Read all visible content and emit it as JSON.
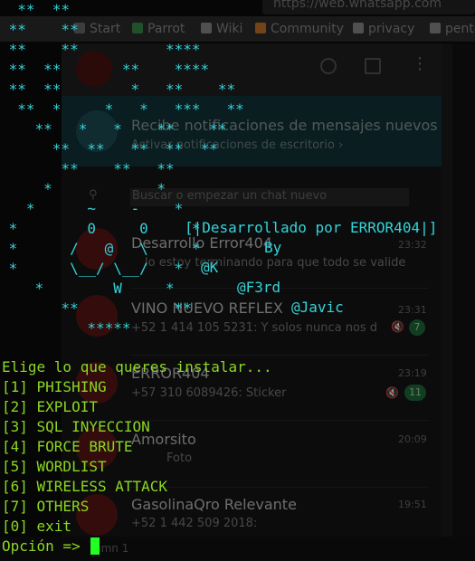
{
  "browser": {
    "url": "https://web.whatsapp.com",
    "bookmarks": [
      {
        "label": "Start",
        "color": "#6a6a6a"
      },
      {
        "label": "Parrot",
        "color": "#3a8a4a"
      },
      {
        "label": "Wiki",
        "color": "#8a8a8a"
      },
      {
        "label": "Community",
        "color": "#c9762a"
      },
      {
        "label": "privacy",
        "color": "#8a8a8a"
      },
      {
        "label": "pente",
        "color": "#8a8a8a"
      }
    ]
  },
  "whatsapp": {
    "notification": {
      "title": "Recibe notificaciones de mensajes nuevos",
      "link": "Activar notificaciones de escritorio ›"
    },
    "search_placeholder": "Buscar o empezar un chat nuevo",
    "chats": [
      {
        "name": "Desarrollo Error404",
        "message": "lo estoy terminando para que todo se valide",
        "time": "23:32",
        "badge": ""
      },
      {
        "name": "VINO NUEVO REFLEX",
        "message": "+52 1 414 105 5231: Y solos nunca nos d",
        "time": "23:31",
        "badge": "7"
      },
      {
        "name": "ERROR404",
        "message": "+57 310 6089426: Sticker",
        "time": "23:19",
        "badge": "11"
      },
      {
        "name": "Amorsito",
        "message": "Foto",
        "time": "20:09",
        "badge": ""
      },
      {
        "name": "GasolinaQro Relevante",
        "message": "+52 1 442 509 2018:",
        "time": "19:51",
        "badge": ""
      }
    ],
    "status_hint": "umn 1"
  },
  "terminal": {
    "art_stars": [
      "  **  **",
      " **    **",
      " **    **          ****",
      " **  **       **    ****",
      " **  **        *   **    **",
      "  **  *     *   *   ***   **",
      "    **   *   *    **    **",
      "      **  **   **  **  **",
      "       **    **   **",
      "     *            *",
      "   *      ~    -    *",
      " *        0     0     *",
      " *      /   @   \\     *",
      " *      \\__/ \\__/   *",
      "    *        W     *",
      "       **           **",
      "          *****"
    ],
    "credits": {
      "title": "[|Desarrollado por ERROR404|]",
      "by": "By",
      "author1": "@K",
      "author2": "@F3rd",
      "author3": "@Javic"
    },
    "menu_title": "Elige lo que queres instalar...",
    "options": [
      "[1] PHISHING",
      "[2] EXPLOIT",
      "[3] SQL INYECCION",
      "[4] FORCE BRUTE",
      "[5] WORDLIST",
      "[6] WIRELESS ATTACK",
      "[7] OTHERS",
      "[0] exit"
    ],
    "prompt": "Opción => "
  },
  "colors": {
    "terminal_green": "#8bd624",
    "art_cyan": "#34d3d9",
    "cursor": "#22ff22",
    "whatsapp_badge": "#1f6a3a"
  }
}
